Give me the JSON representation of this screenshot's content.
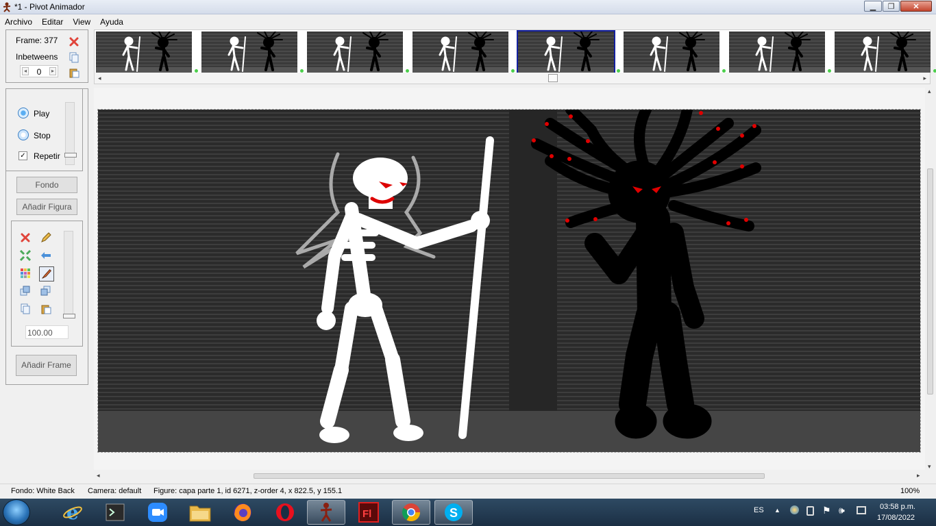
{
  "window": {
    "title": "*1 - Pivot Animador"
  },
  "menu": [
    "Archivo",
    "Editar",
    "View",
    "Ayuda"
  ],
  "frame_panel": {
    "frame_label": "Frame: 377",
    "inbetweens_label": "Inbetweens",
    "inbetweens_value": "0"
  },
  "playback": {
    "play": "Play",
    "stop": "Stop",
    "repeat": "Repetir",
    "repeat_checked": "✓"
  },
  "buttons": {
    "fondo": "Fondo",
    "add_figure": "Añadir Figura",
    "add_frame": "Añadir Frame"
  },
  "tools": {
    "scale_value": "100.00"
  },
  "timeline": {
    "frame_count_visible": 8,
    "selected_index": 4
  },
  "status": {
    "fondo": "Fondo: White Back",
    "camera": "Camera: default",
    "figure": "Figure: capa parte 1,  id 6271,  z-order 4,  x 822.5, y 155.1",
    "zoom": "100%"
  },
  "taskbar": {
    "apps": [
      "windows-explorer",
      "internet-explorer",
      "cmd",
      "zoom",
      "file-explorer",
      "firefox",
      "opera",
      "pivot-animador",
      "flash",
      "chrome",
      "skype"
    ],
    "language": "ES",
    "time": "03:58 p.m.",
    "date": "17/08/2022"
  },
  "colors": {
    "accent_selected": "#1420a0",
    "frame_dot": "#4ccf4c",
    "stage_bg": "#2a2a2a"
  }
}
